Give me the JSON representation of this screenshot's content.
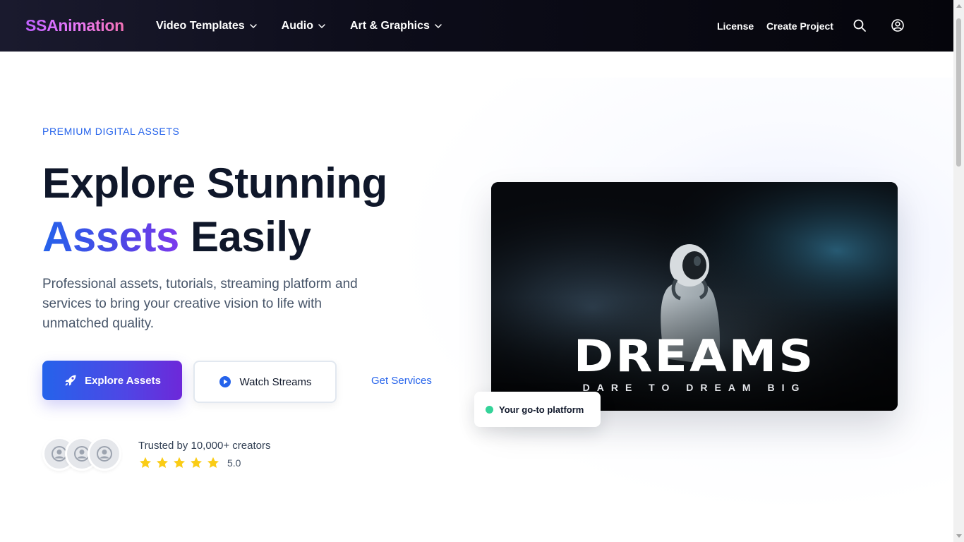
{
  "brand": {
    "name": "SSAnimation"
  },
  "nav": {
    "items": [
      {
        "label": "Video Templates",
        "icon": "chevron-down-icon"
      },
      {
        "label": "Audio",
        "icon": "chevron-down-icon"
      },
      {
        "label": "Art & Graphics",
        "icon": "chevron-down-icon"
      }
    ],
    "license": "License",
    "create_project": "Create Project",
    "search_icon": "search-icon",
    "user_icon": "user-circle-icon"
  },
  "hero": {
    "eyebrow": "PREMIUM DIGITAL ASSETS",
    "headline_line1": "Explore Stunning",
    "headline_accent": "Assets",
    "headline_rest": " Easily",
    "lead": "Professional assets, tutorials, streaming platform and services to bring your creative vision to life with unmatched quality.",
    "cta_primary": "Explore Assets",
    "cta_primary_icon": "rocket-icon",
    "cta_secondary": "Watch Streams",
    "cta_secondary_icon": "play-circle-icon",
    "cta_link": "Get Services",
    "trust_text": "Trusted by 10,000+ creators",
    "rating_stars": 5,
    "rating_value": "5.0"
  },
  "media": {
    "title": "DREAMS",
    "subtitle": "DARE TO DREAM BIG",
    "badge": "Your go-to platform"
  },
  "colors": {
    "accent_blue": "#2563eb",
    "accent_indigo": "#4f46e5",
    "star": "#facc15",
    "badge_dot": "#34d399",
    "nav_bg": "#0d0d1a"
  }
}
